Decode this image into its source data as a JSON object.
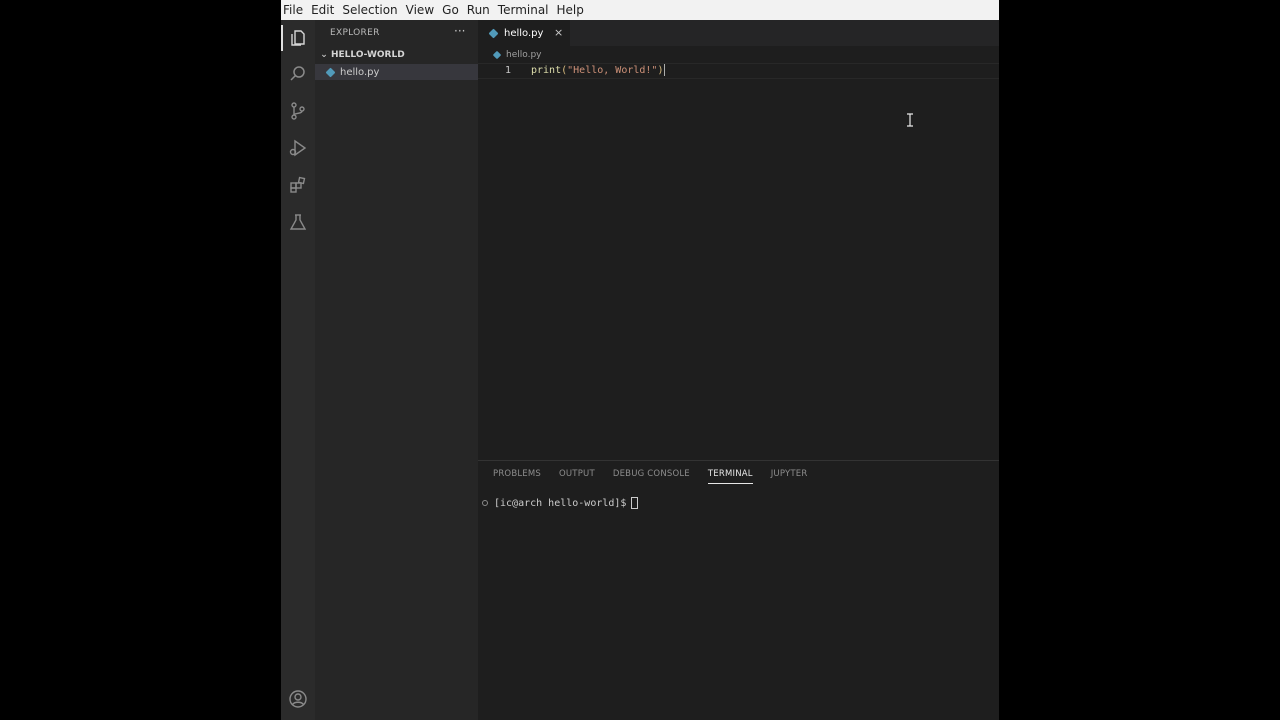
{
  "menubar": {
    "items": [
      "File",
      "Edit",
      "Selection",
      "View",
      "Go",
      "Run",
      "Terminal",
      "Help"
    ]
  },
  "activity_bar": {
    "icons": [
      "files-icon",
      "search-icon",
      "source-control-icon",
      "run-debug-icon",
      "extensions-icon",
      "testing-icon"
    ],
    "bottom_icon": "account-icon"
  },
  "sidebar": {
    "title": "EXPLORER",
    "more_label": "···",
    "folder": "HELLO-WORLD",
    "files": [
      {
        "name": "hello.py",
        "selected": true
      }
    ]
  },
  "editor": {
    "tab": {
      "label": "hello.py",
      "close": "×"
    },
    "breadcrumb": "hello.py",
    "lines": [
      {
        "number": "1",
        "fn": "print",
        "open": "(",
        "string": "\"Hello, World!\"",
        "close": ")"
      }
    ]
  },
  "panel": {
    "tabs": [
      {
        "label": "PROBLEMS",
        "active": false
      },
      {
        "label": "OUTPUT",
        "active": false
      },
      {
        "label": "DEBUG CONSOLE",
        "active": false
      },
      {
        "label": "TERMINAL",
        "active": true
      },
      {
        "label": "JUPYTER",
        "active": false
      }
    ],
    "terminal_prompt": "[ic@arch hello-world]$"
  },
  "colors": {
    "python_icon": "#519aba",
    "string": "#ce9178",
    "function": "#dcdcaa"
  }
}
